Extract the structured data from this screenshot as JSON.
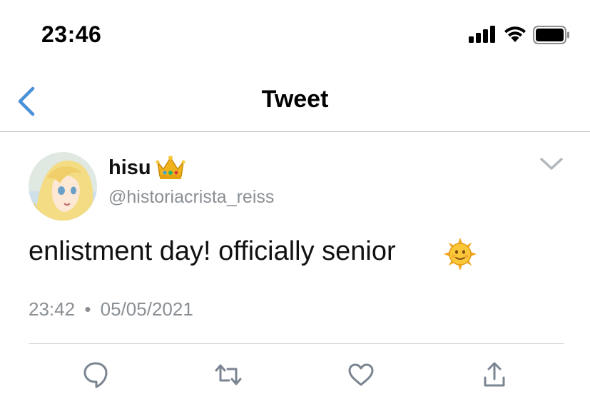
{
  "status_bar": {
    "time": "23:46",
    "icons": [
      "signal-bars-icon",
      "wifi-icon",
      "battery-icon"
    ]
  },
  "nav": {
    "title": "Tweet",
    "back_icon": "chevron-left-icon"
  },
  "tweet": {
    "author": {
      "display_name": "hisu",
      "name_emoji": "crown-icon",
      "handle": "@historiacrista_reiss"
    },
    "text": "enlistment day! officially senior",
    "text_emoji": "sun-with-face-icon",
    "time": "23:42",
    "separator": "•",
    "date": "05/05/2021",
    "menu_icon": "chevron-down-icon"
  },
  "actions": [
    "reply-icon",
    "retweet-icon",
    "like-icon",
    "share-icon"
  ],
  "colors": {
    "accent": "#4a90d9",
    "secondary_text": "#8a8f94",
    "action_icon": "#7b8591"
  }
}
